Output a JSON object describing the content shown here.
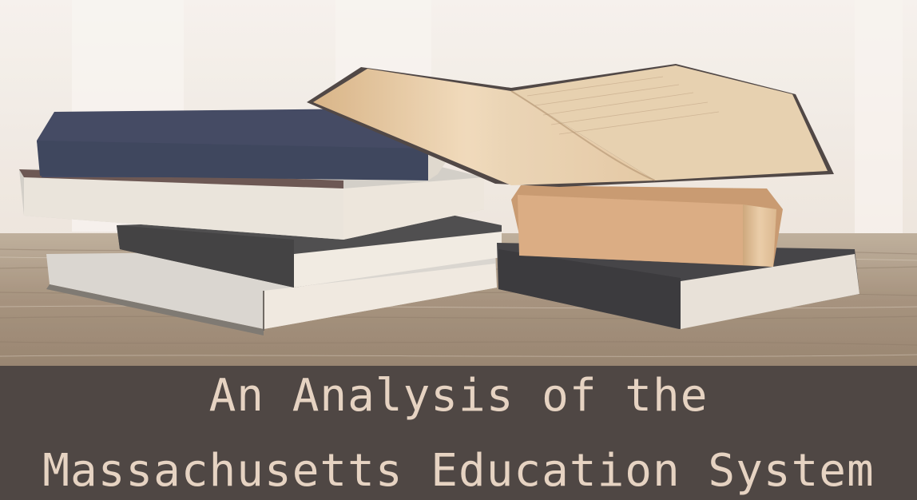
{
  "title": {
    "line1": "An Analysis of the",
    "line2": "Massachusetts Education System"
  },
  "colors": {
    "banner_background": "#4f4744",
    "banner_text": "#e6d3c2",
    "background": "#f3efea"
  }
}
